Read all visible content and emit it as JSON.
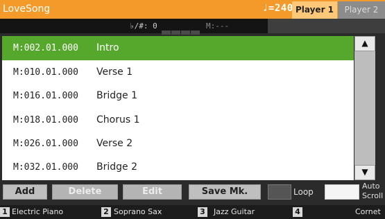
{
  "header": {
    "song_title": "LoveSong",
    "tempo": "♩=240",
    "tabs": [
      {
        "label": "Player 1"
      },
      {
        "label": "Player 2"
      }
    ]
  },
  "info_bar": {
    "accidentals": "♭/#: 0",
    "measure": "M:---"
  },
  "markers": [
    {
      "position": "M:002.01.000",
      "name": "Intro"
    },
    {
      "position": "M:010.01.000",
      "name": "Verse 1"
    },
    {
      "position": "M:016.01.000",
      "name": "Bridge 1"
    },
    {
      "position": "M:018.01.000",
      "name": "Chorus 1"
    },
    {
      "position": "M:026.01.000",
      "name": "Verse 2"
    },
    {
      "position": "M:032.01.000",
      "name": "Bridge 2"
    }
  ],
  "selected_index": 0,
  "scrollbar": {
    "up_icon": "▲",
    "down_icon": "▼"
  },
  "buttons": {
    "add": "Add",
    "delete": "Delete",
    "edit": "Edit",
    "save_mark": "Save Mk.",
    "loop_label": "Loop",
    "auto_scroll_label_1": "Auto",
    "auto_scroll_label_2": "Scroll"
  },
  "instruments": [
    {
      "num": "1",
      "name": "Electric Piano"
    },
    {
      "num": "2",
      "name": "Soprano Sax"
    },
    {
      "num": "3",
      "name": "Jazz Guitar"
    },
    {
      "num": "4",
      "name": "Cornet"
    }
  ],
  "colors": {
    "header": "#f39a2a",
    "selected_row": "#55a82b",
    "active_tab": "#ffc879"
  }
}
